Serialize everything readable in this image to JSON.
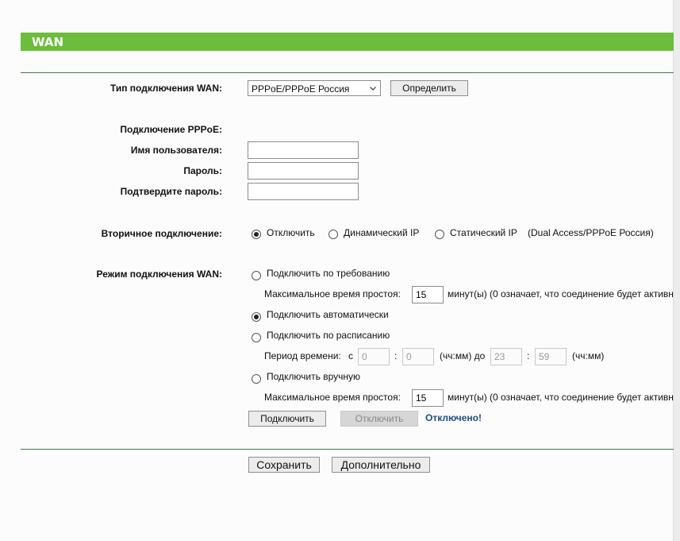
{
  "header": {
    "title": "WAN"
  },
  "wan_type": {
    "label": "Тип подключения WAN:",
    "selected": "PPPoE/PPPoE Россия",
    "detect_button": "Определить"
  },
  "pppoe": {
    "section_label": "Подключение PPPoE:",
    "username_label": "Имя пользователя:",
    "username_value": "",
    "password_label": "Пароль:",
    "password_value": "",
    "confirm_label": "Подтвердите пароль:",
    "confirm_value": ""
  },
  "secondary": {
    "label": "Вторичное подключение:",
    "options": [
      "Отключить",
      "Динамический IP",
      "Статический IP"
    ],
    "selected_index": 0,
    "note": "(Dual Access/PPPoE Россия)"
  },
  "mode": {
    "label": "Режим подключения WAN:",
    "on_demand_label": "Подключить по требованию",
    "idle1_label": "Максимальное время простоя:",
    "idle1_value": "15",
    "idle1_suffix": "минут(ы) (0 означает, что соединение будет активн",
    "auto_label": "Подключить автоматически",
    "schedule_label": "Подключить по расписанию",
    "period_label": "Период времени:",
    "period_from": "с",
    "from_h": "0",
    "from_m": "0",
    "from_unit": "(чч:мм) до",
    "to_h": "23",
    "to_m": "59",
    "to_unit": "(чч:мм)",
    "manual_label": "Подключить вручную",
    "idle2_label": "Максимальное время простоя:",
    "idle2_value": "15",
    "idle2_suffix": "минут(ы) (0 означает, что соединение будет активн",
    "connect_button": "Подключить",
    "disconnect_button": "Отключить",
    "status": "Отключено!",
    "selected": "auto",
    "colon": ":"
  },
  "footer": {
    "save_button": "Сохранить",
    "advanced_button": "Дополнительно"
  }
}
